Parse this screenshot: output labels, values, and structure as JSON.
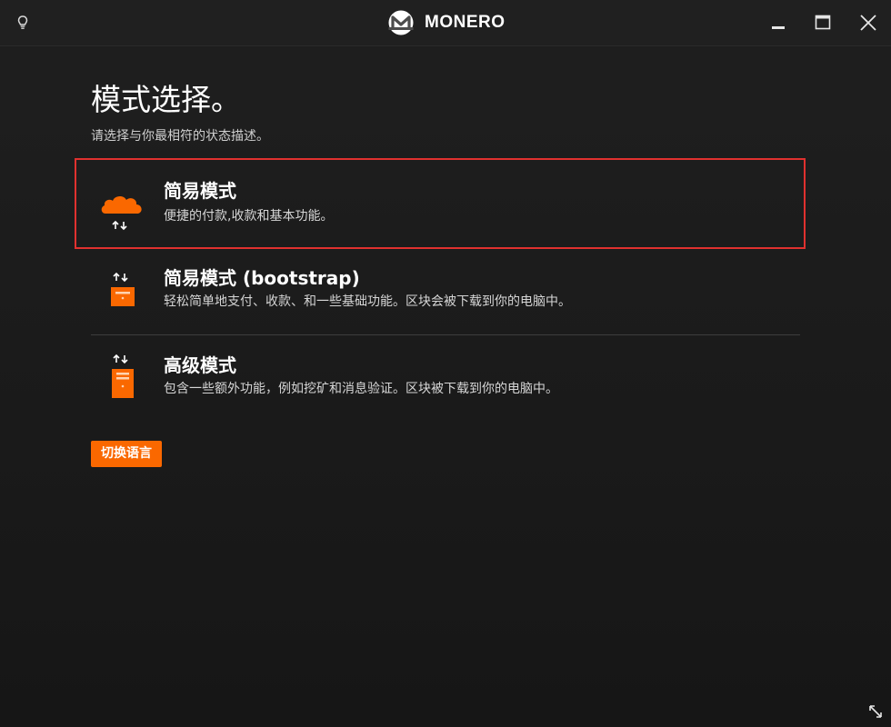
{
  "app": {
    "brand": "MONERO"
  },
  "colors": {
    "accent": "#fa6800",
    "highlight": "#e0312f",
    "background": "#1c1c1c"
  },
  "icons": {
    "titlebar_left": "lightbulb-icon",
    "logo": "monero-logo-icon",
    "minimize": "minimize-icon",
    "maximize": "maximize-icon",
    "close": "close-icon",
    "resize": "resize-arrows-icon"
  },
  "page": {
    "title": "模式选择。",
    "subtitle": "请选择与你最相符的状态描述。"
  },
  "modes": [
    {
      "title": "简易模式",
      "description": "便捷的付款,收款和基本功能。",
      "icon": "cloud-sync-icon"
    },
    {
      "title": "简易模式 (bootstrap)",
      "description": "轻松简单地支付、收款、和一些基础功能。区块会被下载到你的电脑中。",
      "icon": "small-server-sync-icon"
    },
    {
      "title": "高级模式",
      "description": "包含一些额外功能，例如挖矿和消息验证。区块被下载到你的电脑中。",
      "icon": "tall-server-sync-icon"
    }
  ],
  "language_button": {
    "label": "切换语言"
  }
}
